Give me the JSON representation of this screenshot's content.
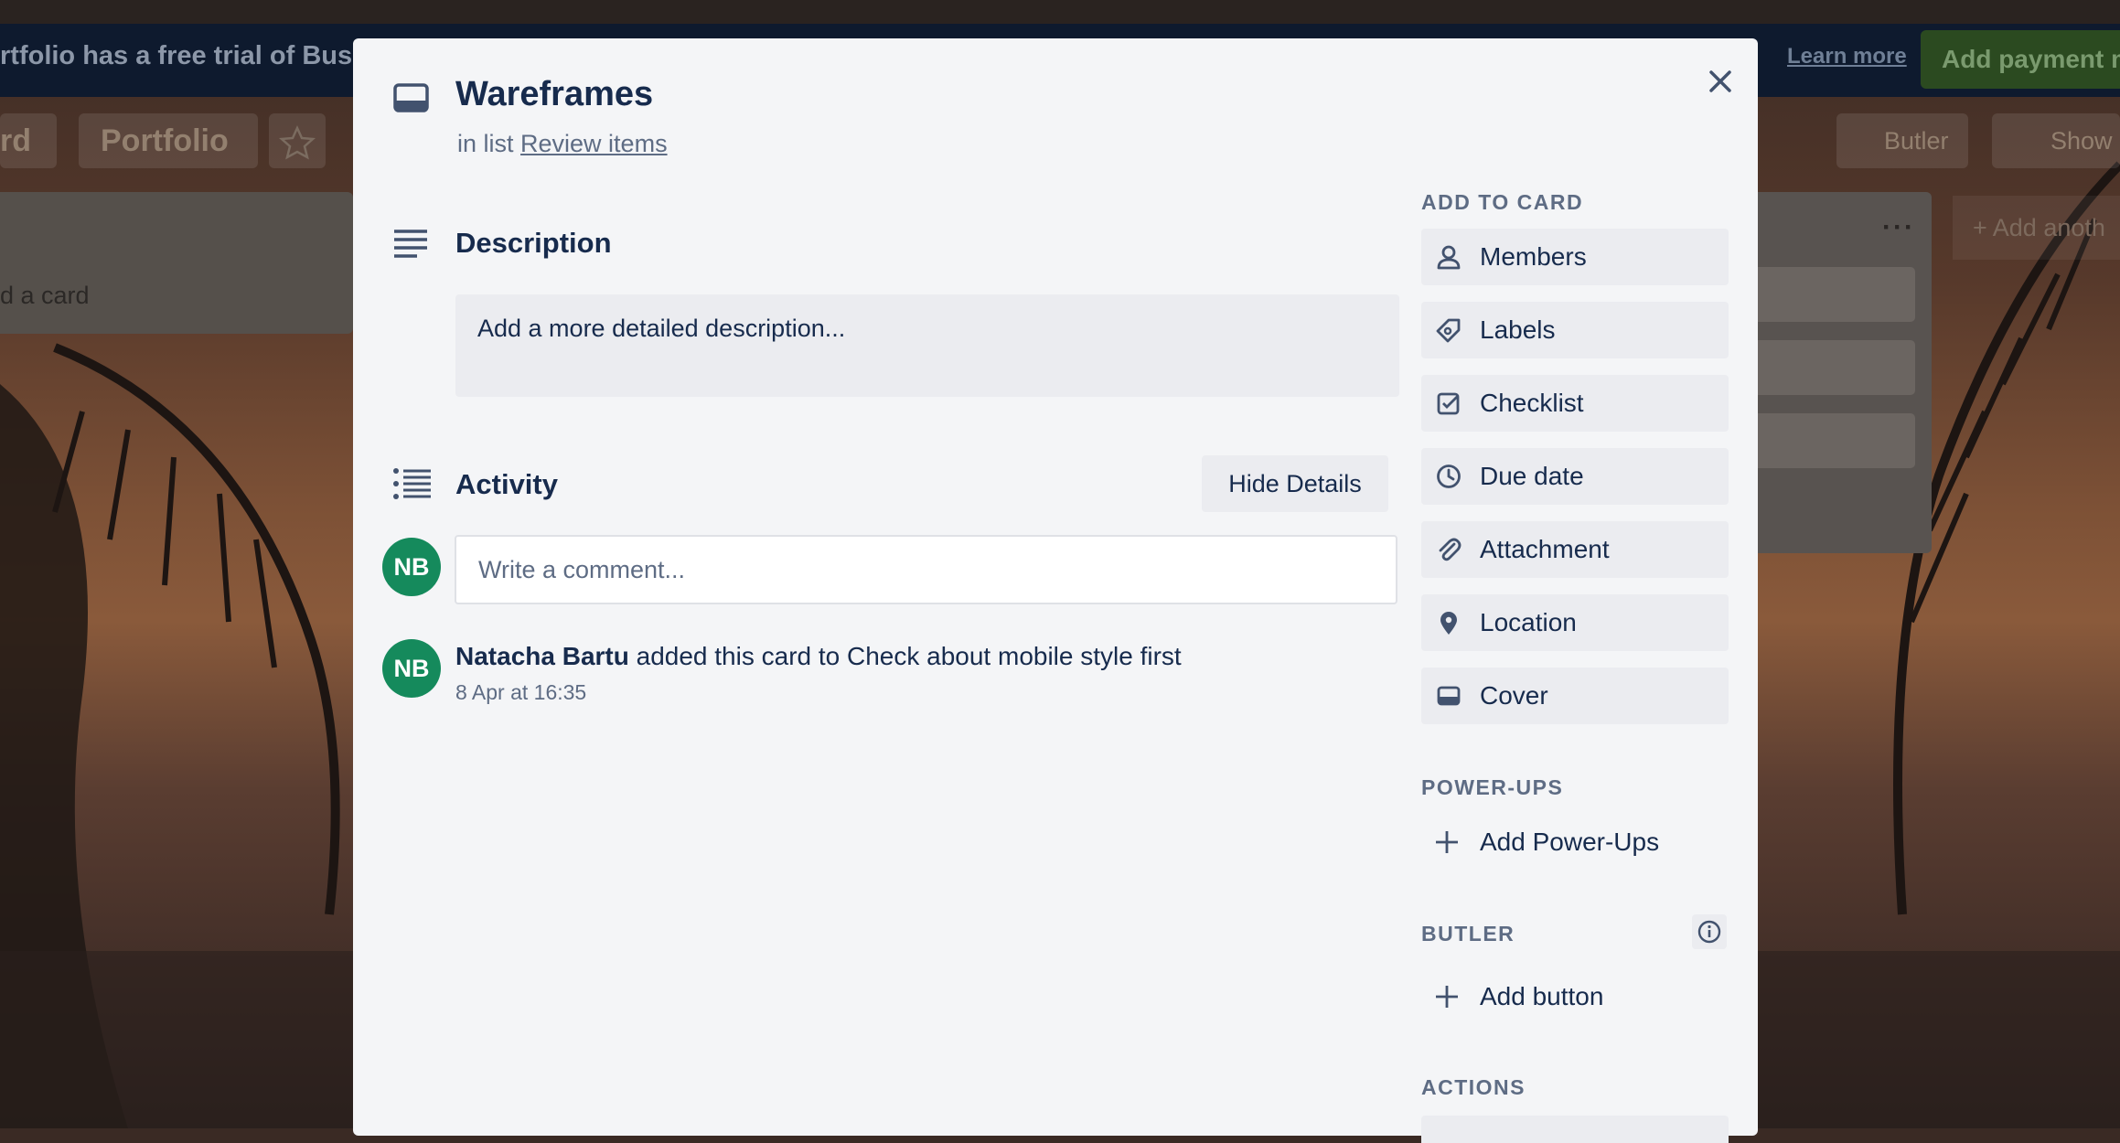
{
  "background": {
    "banner_text": "rtfolio has a free trial of Busin",
    "banner_link": "Learn more",
    "banner_button": "Add payment m",
    "board_switch": "rd",
    "board_name": "Portfolio",
    "butler": "Butler",
    "show_menu": "Show",
    "list_left_add_card": "d a card",
    "add_another_list": "Add anoth"
  },
  "card": {
    "title": "Wareframes",
    "in_list_prefix": "in list",
    "list_name": "Review items"
  },
  "description": {
    "heading": "Description",
    "placeholder": "Add a more detailed description..."
  },
  "activity": {
    "heading": "Activity",
    "hide_details": "Hide Details",
    "comment_placeholder": "Write a comment...",
    "current_user_initials": "NB",
    "entries": [
      {
        "initials": "NB",
        "author": "Natacha Bartu",
        "action": "added this card to Check about mobile style first",
        "time": "8 Apr at 16:35"
      }
    ]
  },
  "sidebar": {
    "add_to_card_heading": "ADD TO CARD",
    "add_to_card": [
      {
        "label": "Members",
        "icon": "person-icon"
      },
      {
        "label": "Labels",
        "icon": "tag-icon"
      },
      {
        "label": "Checklist",
        "icon": "checkbox-icon"
      },
      {
        "label": "Due date",
        "icon": "clock-icon"
      },
      {
        "label": "Attachment",
        "icon": "paperclip-icon"
      },
      {
        "label": "Location",
        "icon": "location-pin-icon"
      },
      {
        "label": "Cover",
        "icon": "cover-icon"
      }
    ],
    "power_ups_heading": "POWER-UPS",
    "add_power_ups": "Add Power-Ups",
    "butler_heading": "BUTLER",
    "add_button": "Add button",
    "actions_heading": "ACTIONS"
  },
  "colors": {
    "modal_bg": "#f4f5f7",
    "button_bg": "#ebecf0",
    "avatar_bg": "#158a5c",
    "text_primary": "#172b4d",
    "text_subtle": "#5e6c84"
  }
}
